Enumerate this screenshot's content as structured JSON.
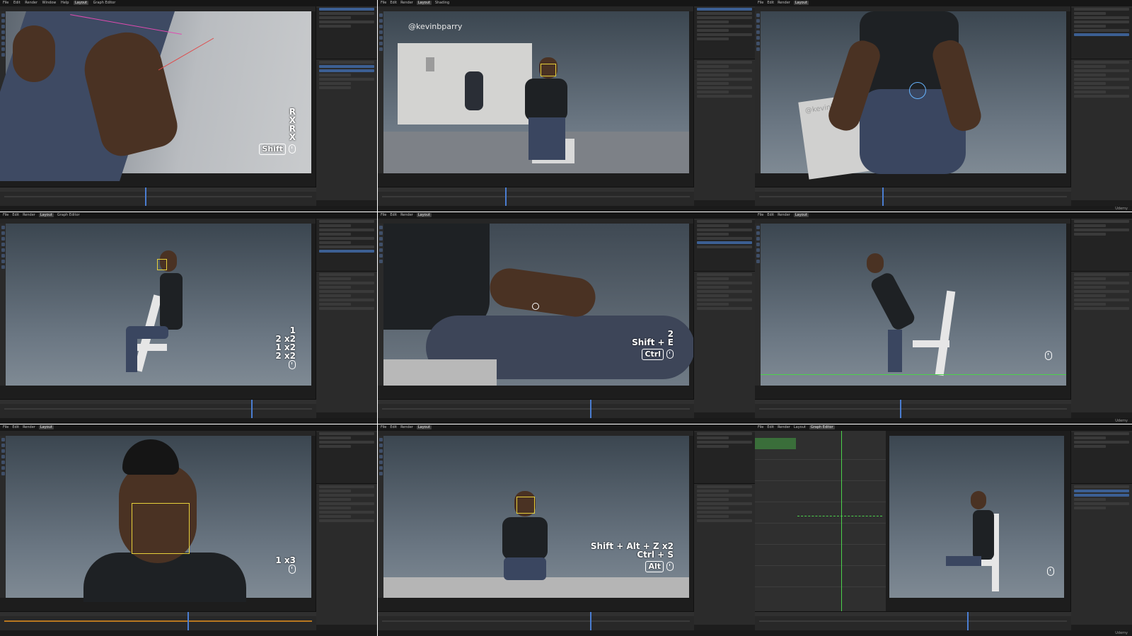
{
  "app": {
    "menu_items": [
      "File",
      "Edit",
      "Render",
      "Window",
      "Help"
    ],
    "workspace_tabs": [
      "Layout",
      "Graph Editor",
      "Shading"
    ],
    "active_workspace": "Layout",
    "platform": "Udemy"
  },
  "tiles": [
    {
      "id": 1,
      "view": "close-up hand on leg with constraints",
      "shortcut_lines": [
        "R",
        "X",
        "R",
        "X"
      ],
      "badge": "Shift",
      "mouse": true
    },
    {
      "id": 2,
      "view": "reference video with seated character",
      "watermark": "@kevinbparry"
    },
    {
      "id": 3,
      "view": "front close-up of seated character rig",
      "watermark": "@kevinbparry"
    },
    {
      "id": 4,
      "view": "side view seated character",
      "shortcut_lines": [
        "1",
        "2 x2",
        "1 x2",
        "2 x2"
      ],
      "mouse": true
    },
    {
      "id": 5,
      "view": "hand on thigh close-up",
      "shortcut_lines": [
        "2",
        "Shift + E"
      ],
      "badge": "Ctrl",
      "mouse": true
    },
    {
      "id": 6,
      "view": "side view character leaning forward",
      "mouse": true
    },
    {
      "id": 7,
      "view": "face rig close-up",
      "shortcut_lines": [
        "1 x3"
      ],
      "mouse": true
    },
    {
      "id": 8,
      "view": "front view kneeling character",
      "shortcut_lines": [
        "Shift + Alt + Z x2",
        "Ctrl + S"
      ],
      "badge": "Alt",
      "mouse": true
    },
    {
      "id": 9,
      "view": "graph editor with side view",
      "mouse": true
    }
  ],
  "colors": {
    "ui_dark": "#1d1d1d",
    "panel": "#2b2b2b",
    "selection_blue": "#3c5f93",
    "rig_yellow": "#e7d03a",
    "rig_green": "#4cd14c"
  }
}
